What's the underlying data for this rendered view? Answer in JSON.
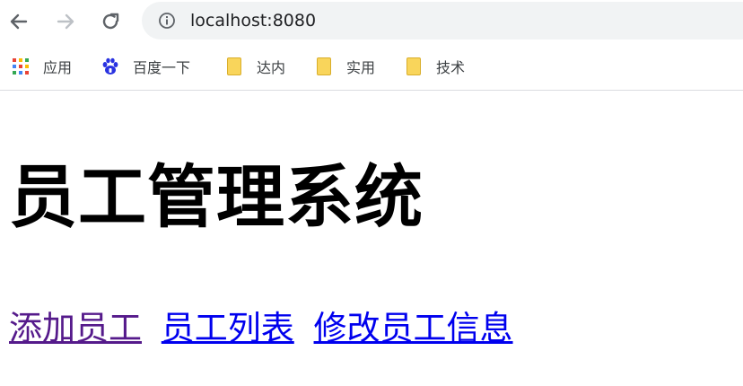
{
  "browser": {
    "url": "localhost:8080",
    "bookmarks": [
      {
        "label": "应用",
        "icon": "apps-grid-icon"
      },
      {
        "label": "百度一下",
        "icon": "baidu-paw-icon"
      },
      {
        "label": "达内",
        "icon": "folder-icon"
      },
      {
        "label": "实用",
        "icon": "folder-icon"
      },
      {
        "label": "技术",
        "icon": "folder-icon"
      }
    ]
  },
  "page": {
    "title": "员工管理系统",
    "links": [
      {
        "label": "添加员工",
        "visited": true
      },
      {
        "label": "员工列表",
        "visited": false
      },
      {
        "label": "修改员工信息",
        "visited": false
      }
    ]
  },
  "colors": {
    "link": "#0000ee",
    "visited_link": "#551a8b",
    "omnibox_bg": "#f1f3f4"
  }
}
